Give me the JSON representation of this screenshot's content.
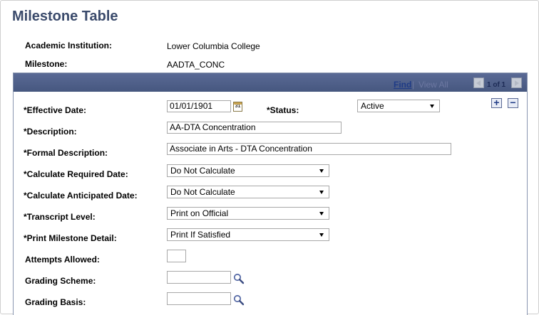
{
  "page": {
    "title": "Milestone Table"
  },
  "header": {
    "institution_label": "Academic Institution:",
    "institution_value": "Lower Columbia College",
    "milestone_label": "Milestone:",
    "milestone_value": "AADTA_CONC"
  },
  "grid_bar": {
    "find": "Find",
    "separator": "|",
    "view_all": "View All",
    "count": "1 of 1"
  },
  "fields": {
    "effective_date": {
      "label": "*Effective Date:",
      "value": "01/01/1901",
      "cal_glyph": "31"
    },
    "status": {
      "label": "*Status:",
      "value": "Active"
    },
    "description": {
      "label": "*Description:",
      "value": "AA-DTA Concentration"
    },
    "formal_description": {
      "label": "*Formal Description:",
      "value": "Associate in Arts - DTA Concentration"
    },
    "calc_required": {
      "label": "*Calculate Required Date:",
      "value": "Do Not Calculate"
    },
    "calc_anticipated": {
      "label": "*Calculate Anticipated Date:",
      "value": "Do Not Calculate"
    },
    "transcript_level": {
      "label": "*Transcript Level:",
      "value": "Print on Official"
    },
    "print_detail": {
      "label": "*Print Milestone Detail:",
      "value": "Print If Satisfied"
    },
    "attempts_allowed": {
      "label": "Attempts Allowed:",
      "value": ""
    },
    "grading_scheme": {
      "label": "Grading Scheme:",
      "value": ""
    },
    "grading_basis": {
      "label": "Grading Basis:",
      "value": ""
    }
  },
  "row_actions": {
    "add": "+",
    "delete": "−"
  },
  "colors": {
    "title": "#3a4a6b",
    "bar": "#4f5f88",
    "link": "#1f3b86"
  }
}
